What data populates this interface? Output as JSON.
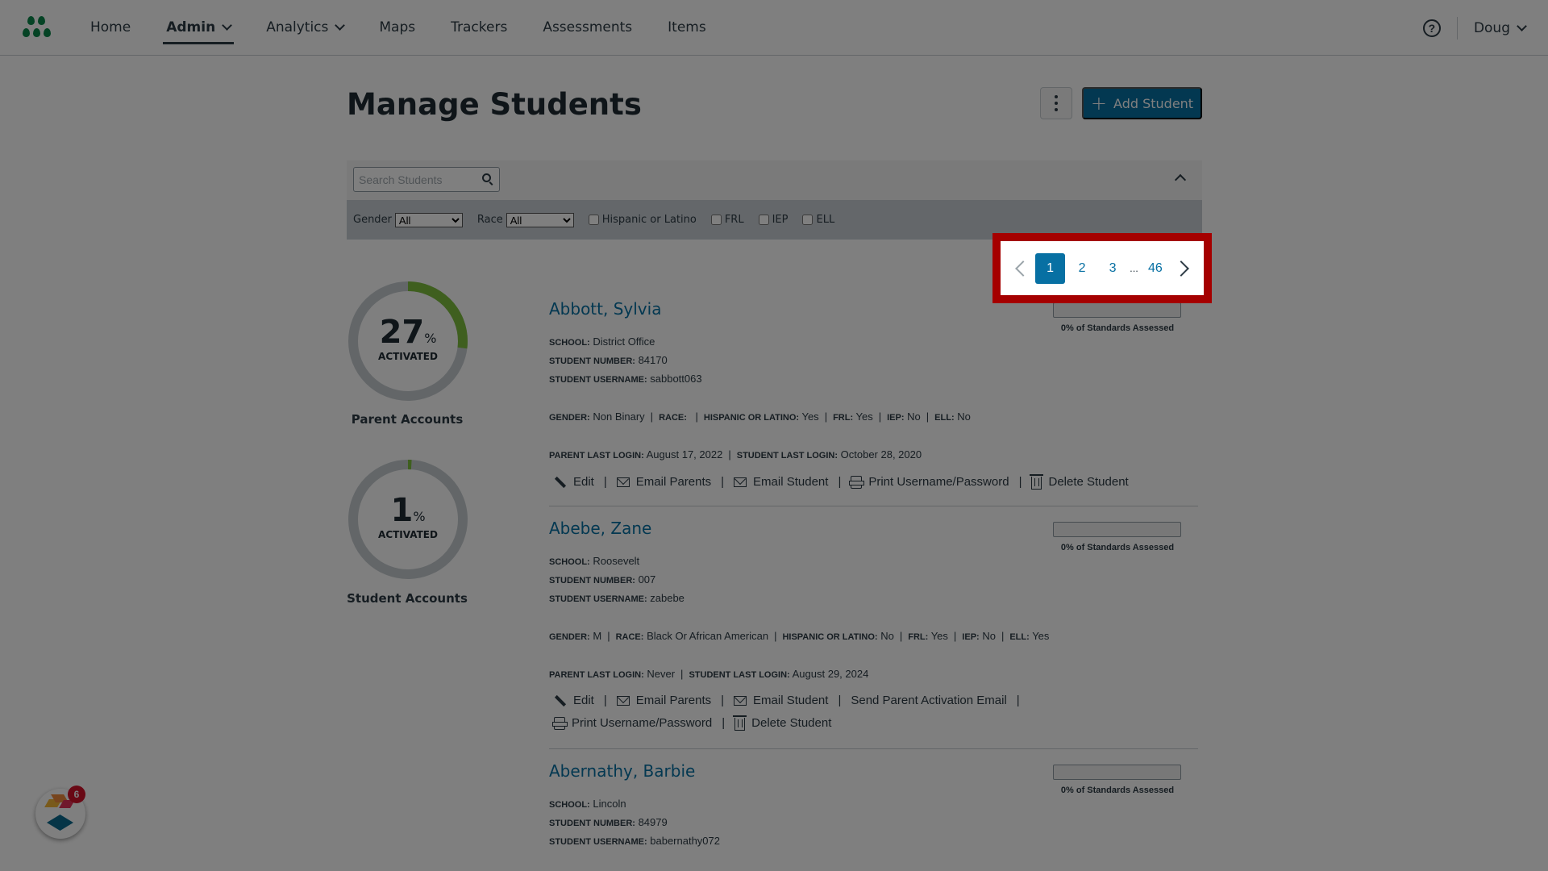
{
  "nav": {
    "items": [
      {
        "label": "Home",
        "active": false,
        "dropdown": false
      },
      {
        "label": "Admin",
        "active": true,
        "dropdown": true
      },
      {
        "label": "Analytics",
        "active": false,
        "dropdown": true
      },
      {
        "label": "Maps",
        "active": false,
        "dropdown": false
      },
      {
        "label": "Trackers",
        "active": false,
        "dropdown": false
      },
      {
        "label": "Assessments",
        "active": false,
        "dropdown": false
      },
      {
        "label": "Items",
        "active": false,
        "dropdown": false
      }
    ],
    "help_icon": "?",
    "user": "Doug"
  },
  "header": {
    "title": "Manage Students",
    "add_button": "Add Student",
    "add_icon": "+"
  },
  "filters": {
    "search_placeholder": "Search Students",
    "gender_label": "Gender",
    "gender_value": "All",
    "race_label": "Race",
    "race_value": "All",
    "checkboxes": [
      "Hispanic or Latino",
      "FRL",
      "IEP",
      "ELL"
    ]
  },
  "stats": [
    {
      "value": "27",
      "percent": 27,
      "unit": "%",
      "caption": "ACTIVATED",
      "label": "Parent Accounts"
    },
    {
      "value": "1",
      "percent": 1,
      "unit": "%",
      "caption": "ACTIVATED",
      "label": "Student Accounts"
    }
  ],
  "pagination": {
    "pages": [
      "1",
      "2",
      "3"
    ],
    "ellipsis": "...",
    "last": "46",
    "current": "1"
  },
  "labels": {
    "school": "SCHOOL:",
    "student_number": "STUDENT NUMBER:",
    "student_username": "STUDENT USERNAME:",
    "gender": "GENDER:",
    "race": "RACE:",
    "hispanic": "HISPANIC OR LATINO:",
    "frl": "FRL:",
    "iep": "IEP:",
    "ell": "ELL:",
    "parent_last_login": "PARENT LAST LOGIN:",
    "student_last_login": "STUDENT LAST LOGIN:",
    "sep": "|",
    "standards_suffix": "of Standards Assessed"
  },
  "students": [
    {
      "name": "Abbott, Sylvia",
      "standards_assessed": "0%",
      "standards_fraction": 0,
      "school": "District Office",
      "student_number": "84170",
      "username": "sabbott063",
      "gender": "Non Binary",
      "race": "",
      "hispanic": "Yes",
      "frl": "Yes",
      "iep": "No",
      "ell": "No",
      "parent_last_login": "August 17, 2022",
      "student_last_login": "October 28, 2020",
      "actions": [
        {
          "label": "Edit",
          "icon": "pencil"
        },
        {
          "label": "Email Parents",
          "icon": "mail"
        },
        {
          "label": "Email Student",
          "icon": "mail"
        },
        {
          "label": "Print Username/Password",
          "icon": "print"
        },
        {
          "label": "Delete Student",
          "icon": "trash"
        }
      ]
    },
    {
      "name": "Abebe, Zane",
      "standards_assessed": "0%",
      "standards_fraction": 0,
      "school": "Roosevelt",
      "student_number": "007",
      "username": "zabebe",
      "gender": "M",
      "race": "Black Or African American",
      "hispanic": "No",
      "frl": "Yes",
      "iep": "No",
      "ell": "Yes",
      "parent_last_login": "Never",
      "student_last_login": "August 29, 2024",
      "actions": [
        {
          "label": "Edit",
          "icon": "pencil"
        },
        {
          "label": "Email Parents",
          "icon": "mail"
        },
        {
          "label": "Email Student",
          "icon": "mail"
        },
        {
          "label": "Send Parent Activation Email",
          "icon": ""
        },
        {
          "label": "Print Username/Password",
          "icon": "print"
        },
        {
          "label": "Delete Student",
          "icon": "trash"
        }
      ]
    },
    {
      "name": "Abernathy, Barbie",
      "standards_assessed": "0%",
      "standards_fraction": 0,
      "school": "Lincoln",
      "student_number": "84979",
      "username": "babernathy072"
    }
  ],
  "widget": {
    "badge_count": "6"
  },
  "colors": {
    "brand_green": "#0b874b",
    "accent_blue": "#0770a3",
    "highlight_red": "#a50000",
    "badge_red": "#d2132b",
    "donut_track": "#c7cdd1",
    "donut_fill": "#7fbf3f"
  }
}
